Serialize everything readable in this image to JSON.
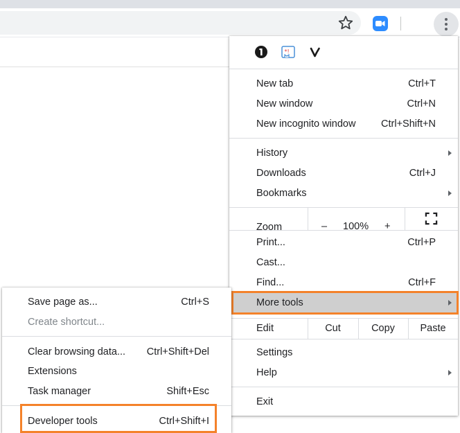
{
  "toolbar": {
    "icons": [
      "star-icon",
      "zoom-extension-icon",
      "more-vert-icon"
    ]
  },
  "main_menu": {
    "extensions": [
      "1password-icon",
      "clipper-extension-icon",
      "vimeo-extension-icon"
    ],
    "new_tab": {
      "label": "New tab",
      "shortcut": "Ctrl+T"
    },
    "new_window": {
      "label": "New window",
      "shortcut": "Ctrl+N"
    },
    "new_incognito": {
      "label": "New incognito window",
      "shortcut": "Ctrl+Shift+N"
    },
    "history": {
      "label": "History"
    },
    "downloads": {
      "label": "Downloads",
      "shortcut": "Ctrl+J"
    },
    "bookmarks": {
      "label": "Bookmarks"
    },
    "zoom": {
      "label": "Zoom",
      "minus": "–",
      "value": "100%",
      "plus": "+"
    },
    "print": {
      "label": "Print...",
      "shortcut": "Ctrl+P"
    },
    "cast": {
      "label": "Cast..."
    },
    "find": {
      "label": "Find...",
      "shortcut": "Ctrl+F"
    },
    "more_tools": {
      "label": "More tools"
    },
    "edit": {
      "label": "Edit",
      "cut": "Cut",
      "copy": "Copy",
      "paste": "Paste"
    },
    "settings": {
      "label": "Settings"
    },
    "help": {
      "label": "Help"
    },
    "exit": {
      "label": "Exit"
    }
  },
  "sub_menu": {
    "save_page": {
      "label": "Save page as...",
      "shortcut": "Ctrl+S"
    },
    "create_shortcut": {
      "label": "Create shortcut..."
    },
    "clear_browsing": {
      "label": "Clear browsing data...",
      "shortcut": "Ctrl+Shift+Del"
    },
    "extensions": {
      "label": "Extensions"
    },
    "task_manager": {
      "label": "Task manager",
      "shortcut": "Shift+Esc"
    },
    "developer_tools": {
      "label": "Developer tools",
      "shortcut": "Ctrl+Shift+I"
    }
  },
  "colors": {
    "highlight_box": "#f4822a",
    "hover_row": "#cfcfcf",
    "zoom_ext_blue": "#2d8cff"
  }
}
